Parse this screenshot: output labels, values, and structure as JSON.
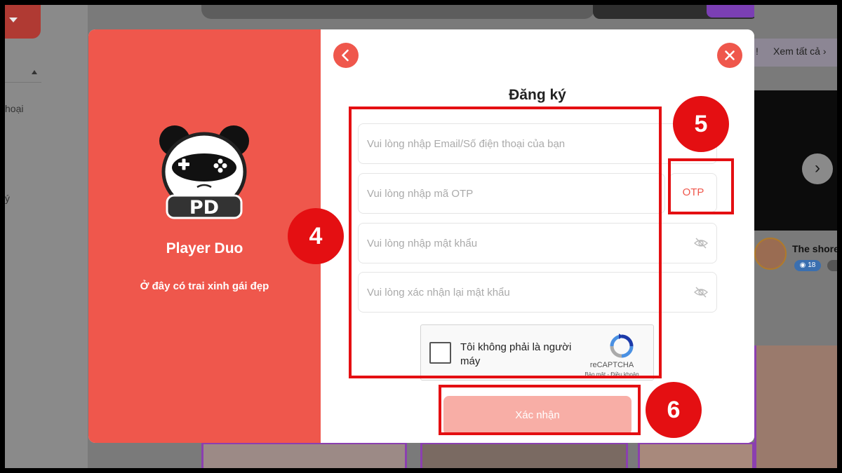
{
  "background": {
    "sidebar_items": [
      {
        "label": "hoại"
      },
      {
        "label": "ý"
      }
    ],
    "view_all_prefix": "!",
    "view_all": "Xem tất cả",
    "featured_name": "The shore",
    "featured_badge": "18"
  },
  "modal": {
    "brand_name": "Player Duo",
    "tagline": "Ở đây có trai xinh gái đẹp",
    "title": "Đăng ký",
    "fields": {
      "email_placeholder": "Vui lòng nhập Email/Số điện thoại của bạn",
      "otp_placeholder": "Vui lòng nhập mã OTP",
      "password_placeholder": "Vui lòng nhập mật khẩu",
      "confirm_placeholder": "Vui lòng xác nhận lại mật khẩu"
    },
    "otp_button": "OTP",
    "recaptcha": {
      "label": "Tôi không phải là người máy",
      "brand": "reCAPTCHA",
      "links": "Bảo mật - Điều khoản"
    },
    "submit_label": "Xác nhận"
  },
  "annotations": {
    "step_4": "4",
    "step_5": "5",
    "step_6": "6"
  },
  "colors": {
    "brand_red": "#ef574c",
    "submit_disabled": "#f8aea6",
    "annotation_red": "#e40f12"
  }
}
